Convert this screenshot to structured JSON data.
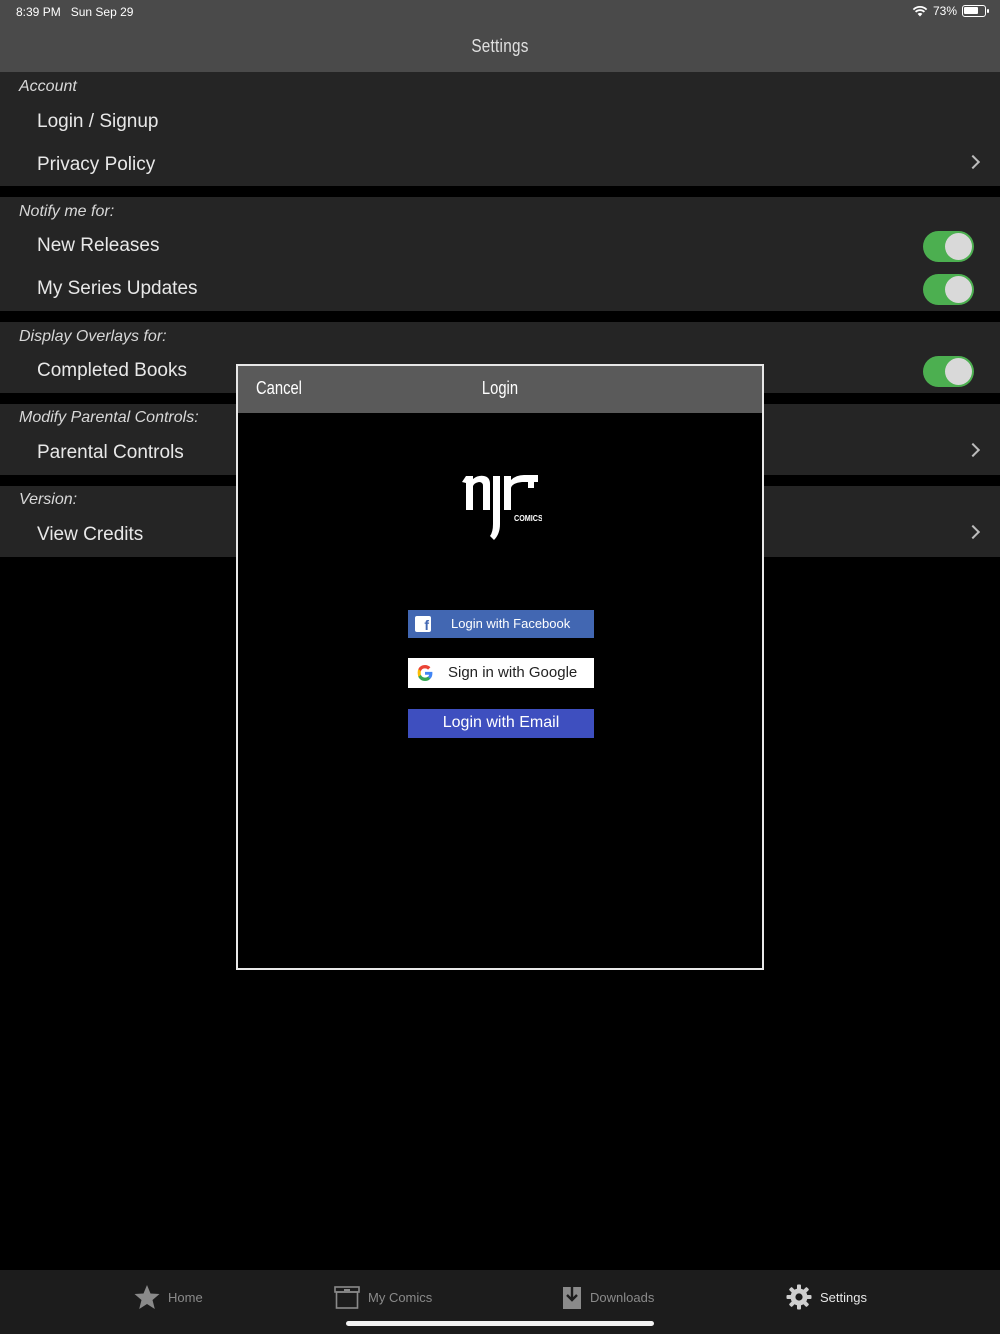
{
  "status": {
    "time": "8:39 PM",
    "date": "Sun Sep 29",
    "battery": "73%",
    "battery_level": 0.73
  },
  "nav": {
    "title": "Settings"
  },
  "sections": {
    "account": {
      "header": "Account",
      "login": "Login / Signup",
      "privacy": "Privacy Policy"
    },
    "notify": {
      "header": "Notify me for:",
      "new_releases": "New Releases",
      "series_updates": "My Series Updates",
      "new_releases_on": true,
      "series_updates_on": true
    },
    "overlays": {
      "header": "Display Overlays for:",
      "completed": "Completed Books",
      "completed_on": true
    },
    "parental": {
      "header": "Modify Parental Controls:",
      "controls": "Parental Controls"
    },
    "version": {
      "header": "Version:",
      "credits": "View Credits"
    }
  },
  "modal": {
    "cancel": "Cancel",
    "title": "Login",
    "logo_text": "njr COMICS",
    "facebook": "Login with Facebook",
    "google": "Sign in with Google",
    "email": "Login with Email"
  },
  "tabs": [
    {
      "label": "Home",
      "icon": "star-icon"
    },
    {
      "label": "My Comics",
      "icon": "archive-box-icon"
    },
    {
      "label": "Downloads",
      "icon": "download-icon"
    },
    {
      "label": "Settings",
      "icon": "gear-icon",
      "active": true
    }
  ],
  "colors": {
    "toggle_on": "#4caf50",
    "facebook": "#4267b2",
    "email_button": "#3e4fbf"
  }
}
